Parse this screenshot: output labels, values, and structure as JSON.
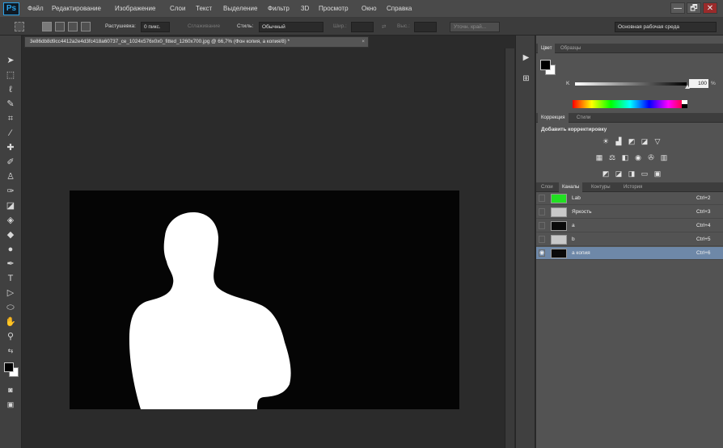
{
  "app": {
    "logo": "Ps"
  },
  "menu": [
    "Файл",
    "Редактирование",
    "Изображение",
    "Слои",
    "Текст",
    "Выделение",
    "Фильтр",
    "3D",
    "Просмотр",
    "Окно",
    "Справка"
  ],
  "window_controls": {
    "minimize": "—",
    "restore": "🗗",
    "close": "✕"
  },
  "options_bar": {
    "feather_label": "Растушевка:",
    "feather_value": "0 пикс.",
    "antialias_label": "Сглаживание",
    "style_label": "Стиль:",
    "style_value": "Обычный",
    "width_label": "Шир.:",
    "height_label": "Выс.:",
    "refine_edge": "Уточн. край...",
    "workspace": "Основная рабочая среда"
  },
  "document": {
    "tab_title": "3e86db8d9cc4412a2e4d3fc418a60737_ce_1024x576x0x0_fitted_1260x700.jpg @ 66,7% (Фон копия, а копия/8) *",
    "close": "×"
  },
  "color_panel": {
    "tabs": [
      "Цвет",
      "Образцы"
    ],
    "channel_label": "K",
    "value": "100",
    "unit": "%"
  },
  "adjustments_panel": {
    "tabs": [
      "Коррекция",
      "Стили"
    ],
    "title": "Добавить корректировку",
    "icons": [
      "brightness-icon",
      "levels-icon",
      "curves-icon",
      "exposure-icon",
      "vibrance-icon",
      "hue-saturation-icon",
      "color-balance-icon",
      "black-white-icon",
      "photo-filter-icon",
      "channel-mixer-icon",
      "color-lookup-icon",
      "invert-icon",
      "posterize-icon",
      "threshold-icon",
      "gradient-map-icon",
      "selective-color-icon"
    ]
  },
  "channels_panel": {
    "tabs": [
      "Слои",
      "Каналы",
      "Контуры",
      "История"
    ],
    "channels": [
      {
        "name": "Lab",
        "shortcut": "Ctrl+2"
      },
      {
        "name": "Яркость",
        "shortcut": "Ctrl+3"
      },
      {
        "name": "a",
        "shortcut": "Ctrl+4"
      },
      {
        "name": "b",
        "shortcut": "Ctrl+5"
      },
      {
        "name": "а копия",
        "shortcut": "Ctrl+6"
      }
    ]
  },
  "colors": {
    "ui_background": "#2b2b2b",
    "panel": "#535353",
    "selection": "#6e88a8",
    "lab_thumb": "#22e022"
  }
}
